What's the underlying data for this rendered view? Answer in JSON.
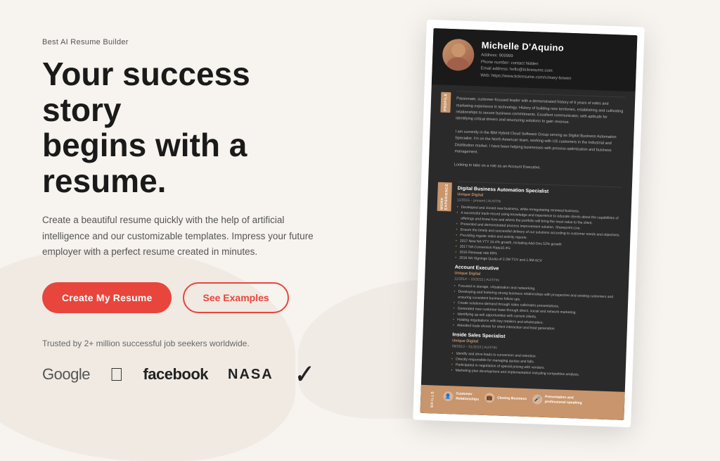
{
  "tagline": "Best AI Resume Builder",
  "headline_line1": "Your success story",
  "headline_line2": "begins with a resume.",
  "description": "Create a beautiful resume quickly with the help of artificial intelligence and our customizable templates. Impress your future employer with a perfect resume created in minutes.",
  "buttons": {
    "primary": "Create My Resume",
    "secondary": "See Examples"
  },
  "trusted": "Trusted by 2+ million successful job seekers worldwide.",
  "brands": [
    "Google",
    "apple",
    "facebook",
    "NASA",
    "nike"
  ],
  "resume": {
    "name": "Michelle D'Aquino",
    "address": "Address: 909999",
    "phone": "Phone number: contact hidden",
    "email": "Email address: hello@tickresume.com",
    "web": "Web: https://www.tickresume.com/c/mary-bowen",
    "profile_label": "PROFILE",
    "profile_text": "Passionate, customer-focused leader with a demonstrated history of 6 years of sales and marketing experience in technology. History of building new territories, establishing and cultivating relationships to secure business commitments. Excellent communicator with aptitude for identifying critical drivers and structuring solutions to gain revenue.\n\nI am currently in the IBM Hybrid Cloud Software Group serving as Digital Business Automation Specialist. I'm on the North American team, working with US customers in the Industrial and Distribution market. I have been helping businesses with process optimization and business management.\n\nLooking to take on a role as an Account Executive.",
    "work_label": "WORK EXPERIENCE",
    "jobs": [
      {
        "title": "Digital Business Automation Specialist",
        "company": "Unique Digital",
        "date": "11/2015 – present | AUSTIN",
        "bullets": [
          "Developed and closed new business, while renegotiating renewed business.",
          "A successful track-record using knowledge and experience to educate clients about the capabilities of offerings and know how and where the portfolio will bring the most value to the client.",
          "Presented and demonstrated process improvement solutions, Sharepoint Live.",
          "Ensure the timely and successful delivery of our solutions according to customer needs and objectives.",
          "Providing regular sales and activity reports.",
          "2017 New NA YTY 24.4% growth, including Add-Ons 52% growth",
          "2017 NA Conversion Rate10.4%",
          "2016 Renewal rate 80%",
          "2016 NA Signings Quota of 2.2M TCV and 1.9M ACV"
        ]
      },
      {
        "title": "Account Executive",
        "company": "Unique Digital",
        "date": "11/2014 – 10/2015 | AUSTIN",
        "bullets": [
          "Focused in storage, virtualization and networking.",
          "Developing and fostering strong business relationships with prospective and existing customers and ensuring consistent business follow ups.",
          "Create solutions-demand through sales calls/sales presentations.",
          "Generated new customer base through direct, social and network marketing.",
          "Identifying up-sell opportunities with current clients.",
          "Holding negotiations with key retailers and wholesalers.",
          "Attended trade shows for client interaction and lead generation."
        ]
      },
      {
        "title": "Inside Sales Specialist",
        "company": "Unique Digital",
        "date": "08/2013 – 01/2015 | AUSTIN",
        "bullets": [
          "Identify and drive leads to conversion and retention.",
          "Directly responsible for managing quotas and falls.",
          "Participated in negotiation of special pricing with vendors.",
          "Marketing plan development and implementation including competitive analysis."
        ]
      }
    ],
    "skills_label": "SKILLS",
    "skills": [
      {
        "icon": "👤",
        "text": "Customer\nRelationships"
      },
      {
        "icon": "💼",
        "text": "Closing Business"
      },
      {
        "icon": "🎤",
        "text": "Presentation and\nprofessional speaking"
      }
    ]
  }
}
